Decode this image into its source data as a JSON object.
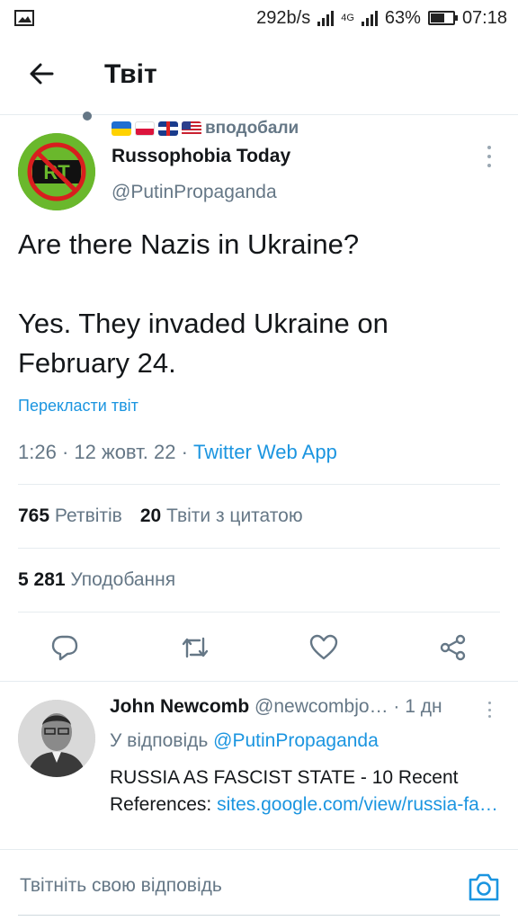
{
  "status_bar": {
    "net_speed": "292b/s",
    "network": "4G",
    "battery": "63%",
    "time": "07:18"
  },
  "header": {
    "title": "Твіт"
  },
  "tweet": {
    "liked_by_label": "вподобали",
    "author_name": "Russophobia Today",
    "author_handle": "@PutinPropaganda",
    "avatar_text": "RT",
    "text": "Are there Nazis in Ukraine?\n\nYes. They invaded Ukraine on February 24.",
    "translate": "Перекласти твіт",
    "time": "1:26",
    "date": "12 жовт. 22",
    "app": "Twitter Web App",
    "retweets_count": "765",
    "retweets_label": "Ретвітів",
    "quotes_count": "20",
    "quotes_label": "Твіти з цитатою",
    "likes_count": "5 281",
    "likes_label": "Уподобання"
  },
  "reply": {
    "author_name": "John Newcomb",
    "author_handle": "@newcombjo…",
    "time": "1 дн",
    "replying_prefix": "У відповідь",
    "replying_handle": "@PutinPropaganda",
    "text": "RUSSIA AS FASCIST STATE  - 10 Recent References:",
    "link": "sites.google.com/view/russia-fa…"
  },
  "composer": {
    "placeholder": "Твітніть свою відповідь"
  },
  "colors": {
    "accent": "#1b95e0",
    "muted": "#657786",
    "avatar_bg": "#6ab82c"
  },
  "icons": [
    "back-arrow-icon",
    "more-vertical-icon",
    "reply-icon",
    "retweet-icon",
    "like-icon",
    "share-icon",
    "camera-icon"
  ]
}
